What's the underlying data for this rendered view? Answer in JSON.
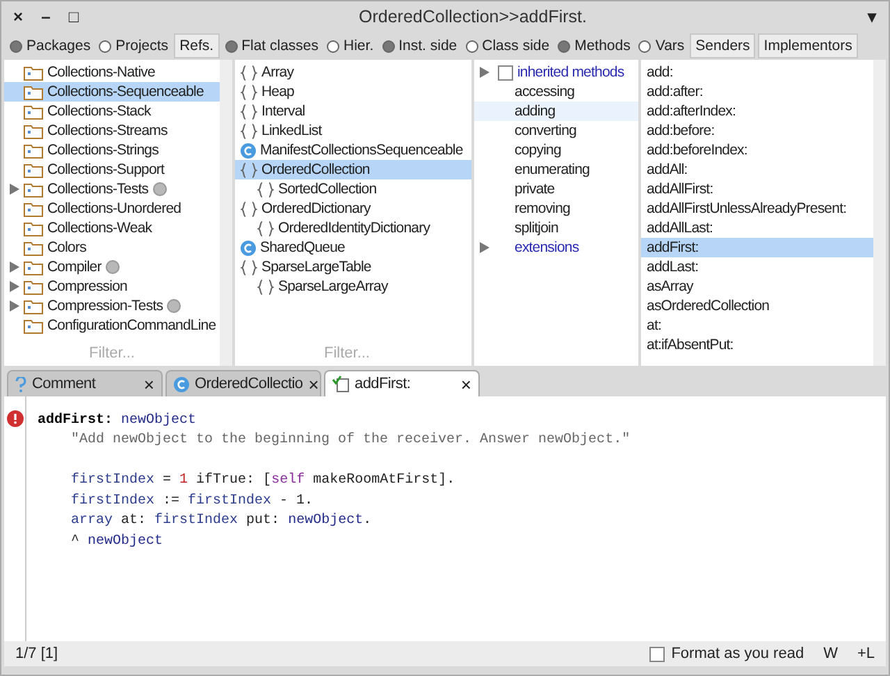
{
  "window": {
    "title": "OrderedCollection>>addFirst.",
    "controls": [
      "×",
      "–",
      "□"
    ],
    "menu": "▾"
  },
  "toolbar": [
    {
      "kind": "radio",
      "label": "Packages",
      "selected": true
    },
    {
      "kind": "radio",
      "label": "Projects",
      "selected": false
    },
    {
      "kind": "button",
      "label": "Refs."
    },
    {
      "kind": "radio",
      "label": "Flat classes",
      "selected": true
    },
    {
      "kind": "radio",
      "label": "Hier.",
      "selected": false
    },
    {
      "kind": "radio",
      "label": "Inst. side",
      "selected": true
    },
    {
      "kind": "radio",
      "label": "Class side",
      "selected": false
    },
    {
      "kind": "radio",
      "label": "Methods",
      "selected": true
    },
    {
      "kind": "radio",
      "label": "Vars",
      "selected": false
    },
    {
      "kind": "button",
      "label": "Senders"
    },
    {
      "kind": "button",
      "label": "Implementors"
    }
  ],
  "packages": {
    "filter_placeholder": "Filter...",
    "items": [
      {
        "name": "Collections-Native",
        "expandable": false,
        "selected": false
      },
      {
        "name": "Collections-Sequenceable",
        "expandable": false,
        "selected": true
      },
      {
        "name": "Collections-Stack",
        "expandable": false,
        "selected": false
      },
      {
        "name": "Collections-Streams",
        "expandable": false,
        "selected": false
      },
      {
        "name": "Collections-Strings",
        "expandable": false,
        "selected": false
      },
      {
        "name": "Collections-Support",
        "expandable": false,
        "selected": false
      },
      {
        "name": "Collections-Tests",
        "expandable": true,
        "badge": true,
        "selected": false
      },
      {
        "name": "Collections-Unordered",
        "expandable": false,
        "selected": false
      },
      {
        "name": "Collections-Weak",
        "expandable": false,
        "selected": false
      },
      {
        "name": "Colors",
        "expandable": false,
        "selected": false
      },
      {
        "name": "Compiler",
        "expandable": true,
        "badge": true,
        "selected": false
      },
      {
        "name": "Compression",
        "expandable": true,
        "selected": false
      },
      {
        "name": "Compression-Tests",
        "expandable": true,
        "badge": true,
        "selected": false
      },
      {
        "name": "ConfigurationCommandLine",
        "expandable": false,
        "selected": false
      }
    ]
  },
  "classes": {
    "filter_placeholder": "Filter...",
    "items": [
      {
        "name": "Array",
        "kind": "brace",
        "selected": false
      },
      {
        "name": "Heap",
        "kind": "brace",
        "selected": false
      },
      {
        "name": "Interval",
        "kind": "brace",
        "selected": false
      },
      {
        "name": "LinkedList",
        "kind": "brace",
        "selected": false
      },
      {
        "name": "ManifestCollectionsSequenceable",
        "kind": "class",
        "selected": false
      },
      {
        "name": "OrderedCollection",
        "kind": "brace",
        "selected": true,
        "children": [
          {
            "name": "SortedCollection",
            "kind": "brace",
            "selected": false
          }
        ]
      },
      {
        "name": "OrderedDictionary",
        "kind": "brace",
        "selected": false,
        "children": [
          {
            "name": "OrderedIdentityDictionary",
            "kind": "brace",
            "selected": false
          }
        ]
      },
      {
        "name": "SharedQueue",
        "kind": "class",
        "selected": false
      },
      {
        "name": "SparseLargeTable",
        "kind": "brace",
        "selected": false,
        "children": [
          {
            "name": "SparseLargeArray",
            "kind": "brace",
            "selected": false
          }
        ]
      }
    ]
  },
  "protocols": [
    {
      "name": "inherited methods",
      "kind": "group",
      "checked": false,
      "selected": false
    },
    {
      "name": "accessing",
      "kind": "plain",
      "selected": false
    },
    {
      "name": "adding",
      "kind": "plain",
      "selected": true
    },
    {
      "name": "converting",
      "kind": "plain",
      "selected": false
    },
    {
      "name": "copying",
      "kind": "plain",
      "selected": false
    },
    {
      "name": "enumerating",
      "kind": "plain",
      "selected": false
    },
    {
      "name": "private",
      "kind": "plain",
      "selected": false
    },
    {
      "name": "removing",
      "kind": "plain",
      "selected": false
    },
    {
      "name": "splitjoin",
      "kind": "plain",
      "selected": false
    },
    {
      "name": "extensions",
      "kind": "group",
      "selected": false
    }
  ],
  "methods": [
    {
      "name": "add:",
      "selected": false
    },
    {
      "name": "add:after:",
      "selected": false
    },
    {
      "name": "add:afterIndex:",
      "selected": false
    },
    {
      "name": "add:before:",
      "selected": false
    },
    {
      "name": "add:beforeIndex:",
      "selected": false
    },
    {
      "name": "addAll:",
      "selected": false
    },
    {
      "name": "addAllFirst:",
      "selected": false
    },
    {
      "name": "addAllFirstUnlessAlreadyPresent:",
      "selected": false
    },
    {
      "name": "addAllLast:",
      "selected": false
    },
    {
      "name": "addFirst:",
      "selected": true
    },
    {
      "name": "addLast:",
      "selected": false
    },
    {
      "name": "asArray",
      "selected": false
    },
    {
      "name": "asOrderedCollection",
      "selected": false
    },
    {
      "name": "at:",
      "selected": false
    },
    {
      "name": "at:ifAbsentPut:",
      "selected": false
    }
  ],
  "tabs": [
    {
      "label": "Comment",
      "kind": "comment",
      "selected": false,
      "close": "×"
    },
    {
      "label": "OrderedCollectio",
      "kind": "class",
      "selected": false,
      "close": "×"
    },
    {
      "label": "addFirst:",
      "kind": "method",
      "selected": true,
      "close": "×"
    }
  ],
  "editor": {
    "error": true,
    "signature": [
      {
        "kind": "selector",
        "text": "addFirst:"
      },
      {
        "kind": "arg",
        "text": " newObject"
      }
    ],
    "comment": [
      {
        "kind": "comment",
        "text": "\"Add newObject to the beginning of the receiver. Answer newObject.\""
      }
    ],
    "statements": [
      [
        {
          "kind": "var",
          "text": "firstIndex"
        },
        {
          "kind": "plain",
          "text": " = "
        },
        {
          "kind": "number",
          "text": "1"
        },
        {
          "kind": "plain",
          "text": " ifTrue: ["
        },
        {
          "kind": "keyword",
          "text": "self"
        },
        {
          "kind": "plain",
          "text": " makeRoomAtFirst]."
        }
      ],
      [
        {
          "kind": "var",
          "text": "firstIndex"
        },
        {
          "kind": "plain",
          "text": " := "
        },
        {
          "kind": "var",
          "text": "firstIndex"
        },
        {
          "kind": "plain",
          "text": " - 1."
        }
      ],
      [
        {
          "kind": "var",
          "text": "array"
        },
        {
          "kind": "plain",
          "text": " at: "
        },
        {
          "kind": "var",
          "text": "firstIndex"
        },
        {
          "kind": "plain",
          "text": " put: "
        },
        {
          "kind": "arg",
          "text": "newObject"
        },
        {
          "kind": "plain",
          "text": "."
        }
      ],
      [
        {
          "kind": "plain",
          "text": "^ "
        },
        {
          "kind": "arg",
          "text": "newObject"
        }
      ]
    ]
  },
  "status_bar": {
    "position": "1/7 [1]",
    "format_label": "Format as you read",
    "format_checked": false,
    "w": "W",
    "l": "+L"
  }
}
